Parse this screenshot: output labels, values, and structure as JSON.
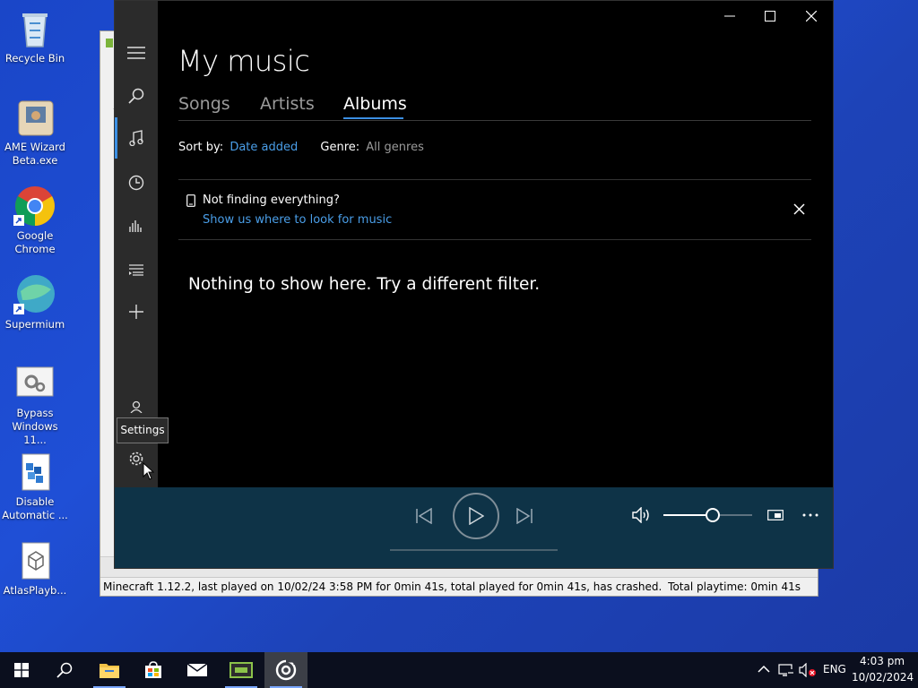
{
  "desktop": {
    "icons": [
      {
        "label": "Recycle Bin"
      },
      {
        "label": "AME Wizard Beta.exe"
      },
      {
        "label": "Google Chrome"
      },
      {
        "label": "Supermium"
      },
      {
        "label": "Bypass Windows 11..."
      },
      {
        "label": "Disable Automatic ..."
      },
      {
        "label": "AtlasPlayb..."
      }
    ]
  },
  "background_window": {
    "status_left": "Minecraft 1.12.2, last played on 10/02/24 3:58 PM for 0min 41s, total played for 0min 41s, has crashed.",
    "status_right": "Total playtime: 0min 41s"
  },
  "music_app": {
    "title": "My music",
    "tabs": [
      {
        "label": "Songs"
      },
      {
        "label": "Artists"
      },
      {
        "label": "Albums",
        "active": true
      }
    ],
    "sort_label": "Sort by:",
    "sort_value": "Date added",
    "genre_label": "Genre:",
    "genre_value": "All genres",
    "notice_title": "Not finding everything?",
    "notice_link": "Show us where to look for music",
    "empty_message": "Nothing to show here. Try a different filter.",
    "tooltip": "Settings",
    "rail_icons": [
      "hamburger-icon",
      "search-icon",
      "music-note-icon",
      "recent-icon",
      "now-playing-icon",
      "playlists-icon",
      "add-icon",
      "account-icon",
      "settings-icon"
    ],
    "player": {
      "volume_percent": 56,
      "buttons": [
        "previous-icon",
        "play-icon",
        "next-icon",
        "volume-icon",
        "mini-player-icon",
        "more-icon"
      ]
    },
    "accent_color": "#3b8fe3"
  },
  "taskbar": {
    "apps": [
      "start-icon",
      "search-icon",
      "file-explorer-icon",
      "store-icon",
      "mail-icon",
      "launcher-icon",
      "groove-music-icon"
    ],
    "language": "ENG",
    "time": "4:03 pm",
    "date": "10/02/2024"
  }
}
